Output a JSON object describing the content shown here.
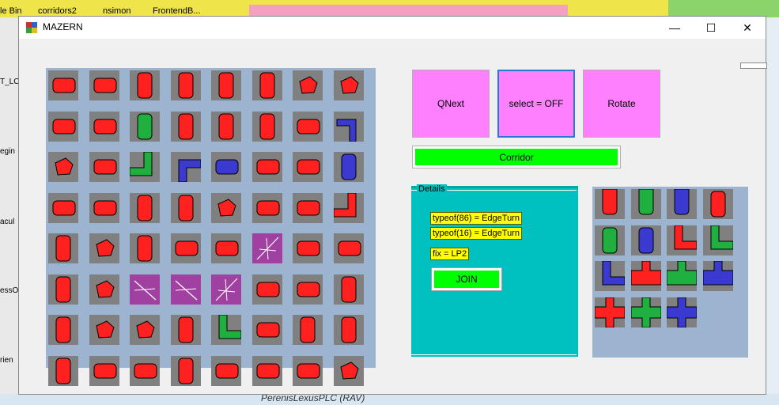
{
  "desktop": {
    "labels": [
      "le Bin",
      "corridors2",
      "nsimon",
      "FrontendB..."
    ],
    "side_labels": [
      "T_LC",
      "egin",
      "acul",
      "essO",
      "rien"
    ],
    "bottom_text": "PerenisLexusPLC (RAV)"
  },
  "window": {
    "title": "MAZERN",
    "minimize": "—",
    "maximize": "☐",
    "close": "✕"
  },
  "colors": {
    "red": "#ff2020",
    "green": "#20b040",
    "blue": "#3a3ad0",
    "purple": "#a040a0",
    "tile_bg": "#808080",
    "board_bg": "#9cb4d0"
  },
  "board": {
    "rows": [
      [
        {
          "shape": "h",
          "color": "red"
        },
        {
          "shape": "h",
          "color": "red"
        },
        {
          "shape": "v",
          "color": "red"
        },
        {
          "shape": "v",
          "color": "red"
        },
        {
          "shape": "v",
          "color": "red"
        },
        {
          "shape": "v",
          "color": "red"
        },
        {
          "shape": "blob",
          "color": "red"
        },
        {
          "shape": "blob",
          "color": "red"
        }
      ],
      [
        {
          "shape": "h",
          "color": "red"
        },
        {
          "shape": "h",
          "color": "red"
        },
        {
          "shape": "v",
          "color": "green"
        },
        {
          "shape": "v",
          "color": "red"
        },
        {
          "shape": "v",
          "color": "red"
        },
        {
          "shape": "v",
          "color": "red"
        },
        {
          "shape": "h",
          "color": "red"
        },
        {
          "shape": "corner-se",
          "color": "blue"
        }
      ],
      [
        {
          "shape": "blob",
          "color": "red"
        },
        {
          "shape": "h",
          "color": "red"
        },
        {
          "shape": "corner-nw",
          "color": "green"
        },
        {
          "shape": "corner-es",
          "color": "blue"
        },
        {
          "shape": "h",
          "color": "blue"
        },
        {
          "shape": "h",
          "color": "red"
        },
        {
          "shape": "h",
          "color": "red"
        },
        {
          "shape": "v",
          "color": "blue"
        }
      ],
      [
        {
          "shape": "h",
          "color": "red"
        },
        {
          "shape": "h",
          "color": "red"
        },
        {
          "shape": "v",
          "color": "red"
        },
        {
          "shape": "v",
          "color": "red"
        },
        {
          "shape": "blob",
          "color": "red"
        },
        {
          "shape": "h",
          "color": "red"
        },
        {
          "shape": "h",
          "color": "red"
        },
        {
          "shape": "corner-nw",
          "color": "red"
        }
      ],
      [
        {
          "shape": "v",
          "color": "red"
        },
        {
          "shape": "blob",
          "color": "red"
        },
        {
          "shape": "v",
          "color": "red"
        },
        {
          "shape": "h",
          "color": "red"
        },
        {
          "shape": "h",
          "color": "red"
        },
        {
          "shape": "cross-purple",
          "color": "purple"
        },
        {
          "shape": "h",
          "color": "red"
        },
        {
          "shape": "h",
          "color": "red"
        }
      ],
      [
        {
          "shape": "v",
          "color": "red"
        },
        {
          "shape": "blob",
          "color": "red"
        },
        {
          "shape": "x-purple",
          "color": "purple"
        },
        {
          "shape": "x-purple",
          "color": "purple"
        },
        {
          "shape": "cross-purple",
          "color": "purple"
        },
        {
          "shape": "h",
          "color": "red"
        },
        {
          "shape": "h",
          "color": "red"
        },
        {
          "shape": "v",
          "color": "red"
        }
      ],
      [
        {
          "shape": "v",
          "color": "red"
        },
        {
          "shape": "blob",
          "color": "red"
        },
        {
          "shape": "blob",
          "color": "red"
        },
        {
          "shape": "v",
          "color": "red"
        },
        {
          "shape": "corner-ne",
          "color": "green"
        },
        {
          "shape": "h",
          "color": "red"
        },
        {
          "shape": "v",
          "color": "red"
        },
        {
          "shape": "v",
          "color": "red"
        }
      ],
      [
        {
          "shape": "v",
          "color": "red"
        },
        {
          "shape": "h",
          "color": "red"
        },
        {
          "shape": "h",
          "color": "red"
        },
        {
          "shape": "v",
          "color": "red"
        },
        {
          "shape": "h",
          "color": "red"
        },
        {
          "shape": "h",
          "color": "red"
        },
        {
          "shape": "h",
          "color": "red"
        },
        {
          "shape": "blob",
          "color": "red"
        }
      ]
    ]
  },
  "buttons": {
    "qnext": "QNext",
    "select": "select = OFF",
    "rotate": "Rotate",
    "corridor": "Corridor",
    "join": "JOIN"
  },
  "details": {
    "legend": "Details",
    "line1": "typeof(86) = EdgeTurn",
    "line2": "typeof(16) = EdgeTurn",
    "line3": "fix = LP2"
  },
  "palette": {
    "rows": [
      [
        {
          "shape": "end-n",
          "color": "red"
        },
        {
          "shape": "end-n",
          "color": "green"
        },
        {
          "shape": "end-n",
          "color": "blue"
        },
        {
          "shape": "v",
          "color": "red"
        }
      ],
      [
        {
          "shape": "v",
          "color": "green"
        },
        {
          "shape": "v",
          "color": "blue"
        },
        {
          "shape": "corner-ne",
          "color": "red"
        },
        {
          "shape": "corner-ne",
          "color": "green"
        }
      ],
      [
        {
          "shape": "corner-ne",
          "color": "blue"
        },
        {
          "shape": "tee",
          "color": "red"
        },
        {
          "shape": "tee",
          "color": "green"
        },
        {
          "shape": "tee",
          "color": "blue"
        }
      ],
      [
        {
          "shape": "plus",
          "color": "red"
        },
        {
          "shape": "plus",
          "color": "green"
        },
        {
          "shape": "plus",
          "color": "blue"
        }
      ]
    ]
  }
}
